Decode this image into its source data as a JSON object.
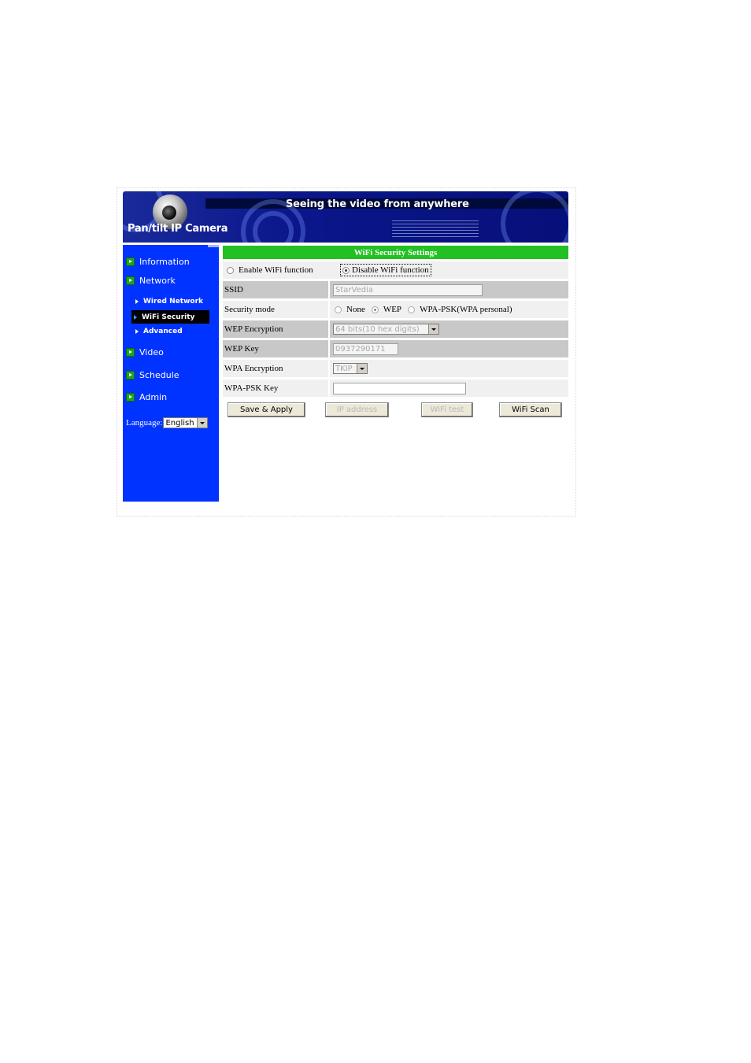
{
  "banner": {
    "title": "Pan/tilt IP Camera",
    "slogan": "Seeing the video from anywhere"
  },
  "sidebar": {
    "items": [
      {
        "label": "Information",
        "icon": "green-arrow-icon"
      },
      {
        "label": "Network",
        "icon": "green-arrow-icon"
      },
      {
        "label": "Video",
        "icon": "green-arrow-icon"
      },
      {
        "label": "Schedule",
        "icon": "green-arrow-icon"
      },
      {
        "label": "Admin",
        "icon": "green-arrow-icon"
      }
    ],
    "subitems": [
      {
        "label": "Wired Network",
        "active": false
      },
      {
        "label": "WiFi Security",
        "active": true
      },
      {
        "label": "Advanced",
        "active": false
      }
    ],
    "language_label": "Language:",
    "language_value": "English"
  },
  "form": {
    "title": "WiFi Security Settings",
    "enable_wifi_label": "Enable WiFi function",
    "disable_wifi_label": "Disable WiFi function",
    "wifi_selected": "disable",
    "ssid_label": "SSID",
    "ssid_value": "StarVedia",
    "security_mode_label": "Security mode",
    "security_options": [
      "None",
      "WEP",
      "WPA-PSK(WPA personal)"
    ],
    "security_selected": "WEP",
    "wep_encryption_label": "WEP Encryption",
    "wep_encryption_value": "64 bits(10 hex digits)",
    "wep_key_label": "WEP Key",
    "wep_key_value": "0937290171",
    "wpa_encryption_label": "WPA Encryption",
    "wpa_encryption_value": "TKIP",
    "wpa_psk_key_label": "WPA-PSK Key",
    "wpa_psk_key_value": ""
  },
  "buttons": {
    "save_apply": "Save & Apply",
    "ip_address": "IP address",
    "wifi_test": "WiFi test",
    "wifi_scan": "WiFi Scan"
  },
  "colors": {
    "sidebar_bg": "#0033ff",
    "header_green": "#22c022",
    "banner_blue": "#0a168a"
  }
}
